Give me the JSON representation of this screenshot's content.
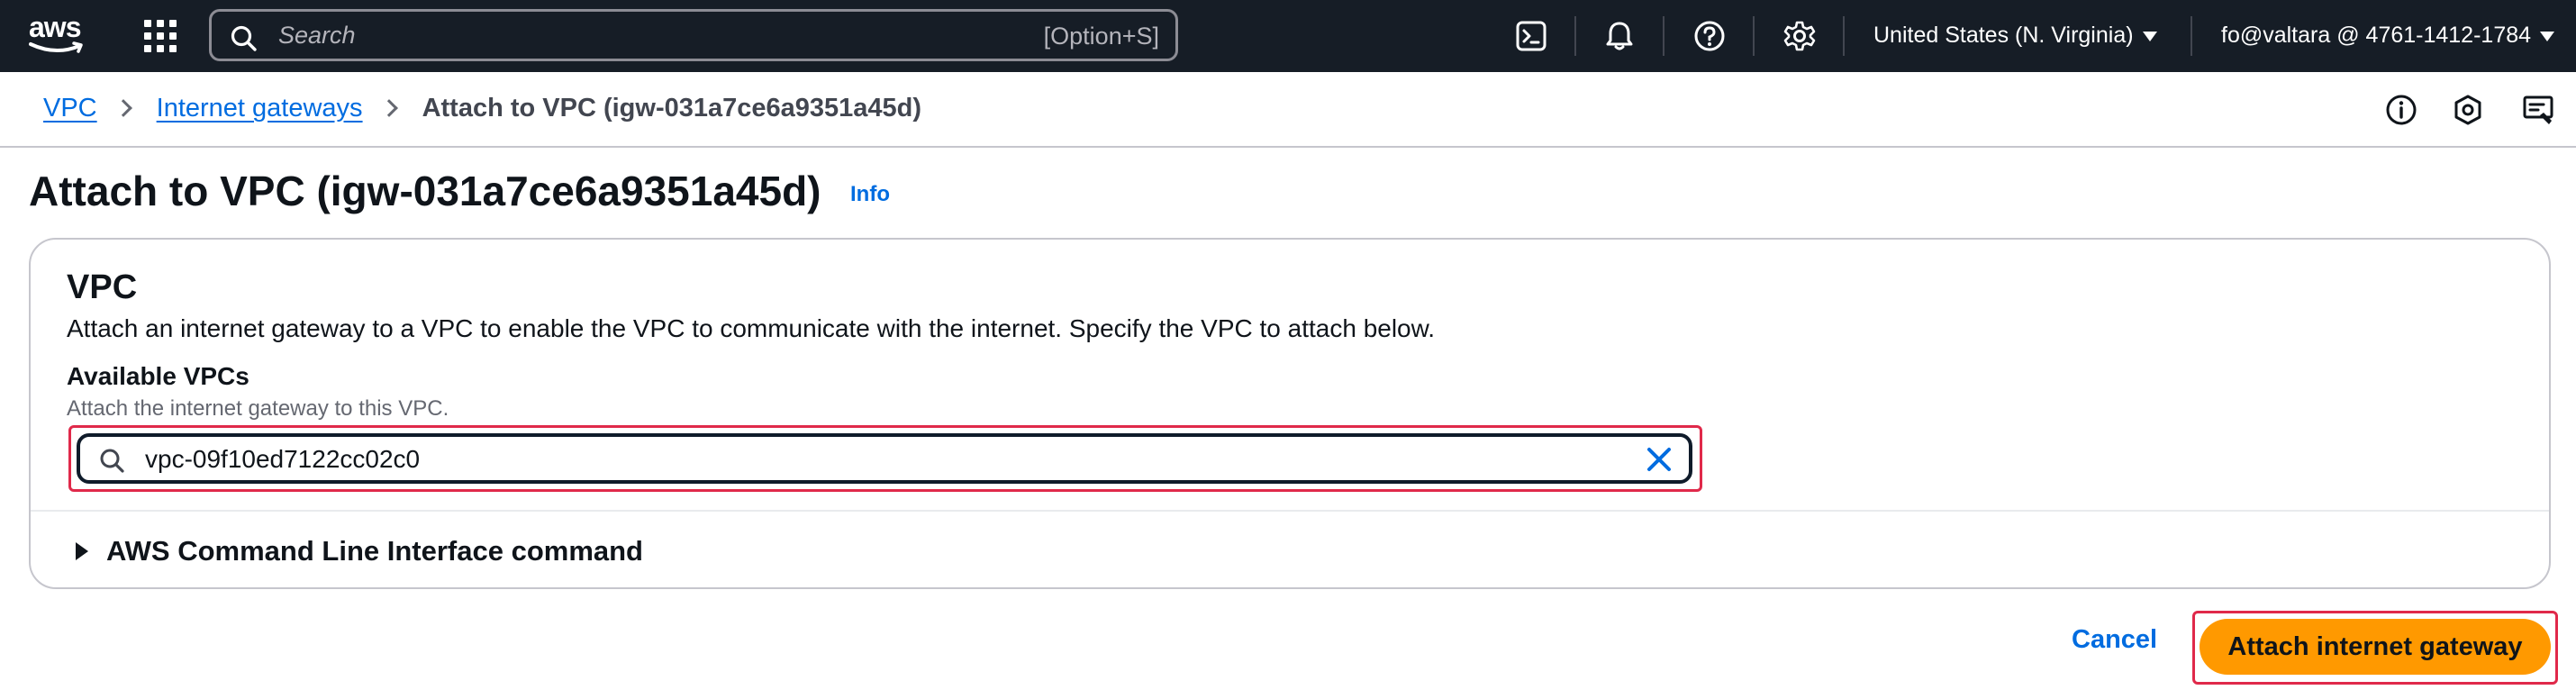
{
  "topnav": {
    "logo": "aws",
    "search": {
      "placeholder": "Search",
      "shortcut": "[Option+S]"
    },
    "icons": [
      "cloudshell-icon",
      "bell-icon",
      "help-icon",
      "gear-icon"
    ],
    "region": "United States (N. Virginia)",
    "account": "fo@valtara @ 4761-1412-1784"
  },
  "breadcrumb": {
    "items": [
      "VPC",
      "Internet gateways"
    ],
    "current": "Attach to VPC (igw-031a7ce6a9351a45d)"
  },
  "page": {
    "title": "Attach to VPC (igw-031a7ce6a9351a45d)",
    "info": "Info"
  },
  "vpc_section": {
    "title": "VPC",
    "description": "Attach an internet gateway to a VPC to enable the VPC to communicate with the internet. Specify the VPC to attach below.",
    "field_label": "Available VPCs",
    "field_description": "Attach the internet gateway to this VPC.",
    "field_value": "vpc-09f10ed7122cc02c0",
    "cli_expander": "AWS Command Line Interface command"
  },
  "actions": {
    "cancel": "Cancel",
    "submit": "Attach internet gateway"
  },
  "colors": {
    "nav_bg": "#161d26",
    "link": "#006ce0",
    "primary": "#ff9900",
    "highlight": "#e0294a"
  }
}
